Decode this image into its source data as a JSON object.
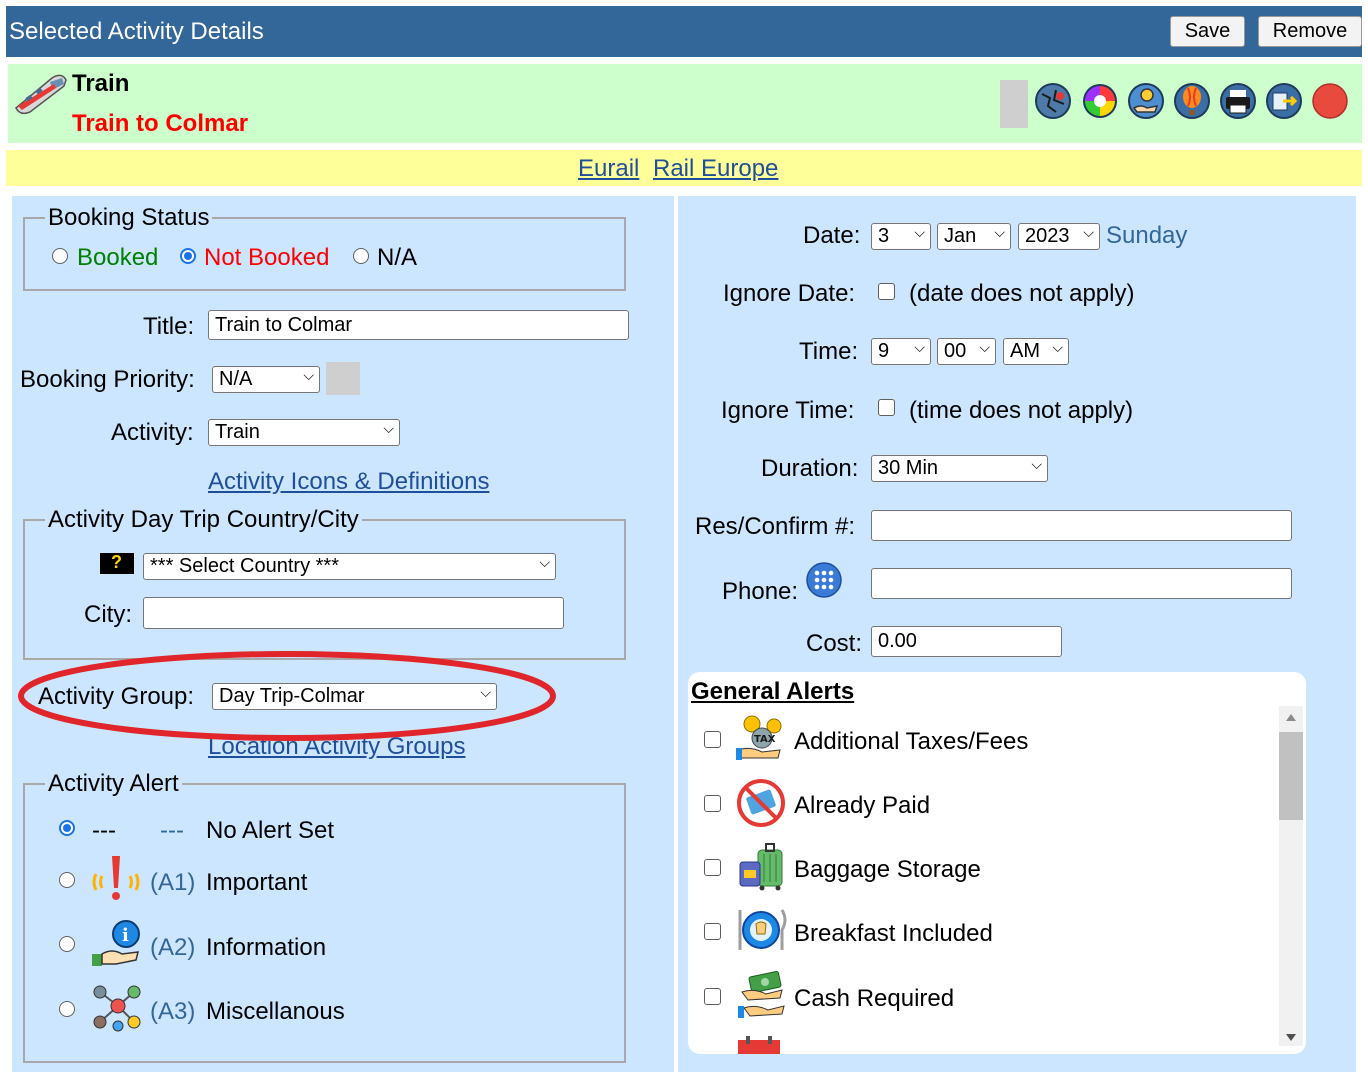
{
  "header": {
    "title": "Selected Activity Details",
    "save_label": "Save",
    "remove_label": "Remove"
  },
  "summary": {
    "type_label": "Train",
    "title": "Train to Colmar"
  },
  "links": {
    "eurail": "Eurail",
    "rail_europe": "Rail Europe"
  },
  "booking_status": {
    "legend": "Booking Status",
    "options": [
      {
        "label": "Booked",
        "color": "#008000",
        "selected": false
      },
      {
        "label": "Not Booked",
        "color": "#ff0000",
        "selected": true
      },
      {
        "label": "N/A",
        "color": "#000000",
        "selected": false
      }
    ]
  },
  "form_left": {
    "title_label": "Title:",
    "title_value": "Train to Colmar",
    "priority_label": "Booking Priority:",
    "priority_value": "N/A",
    "activity_label": "Activity:",
    "activity_value": "Train",
    "activity_icons_link": "Activity Icons & Definitions"
  },
  "day_trip": {
    "legend": "Activity Day Trip Country/City",
    "country_value": "*** Select Country ***",
    "city_label": "City:",
    "city_value": ""
  },
  "activity_group": {
    "label": "Activity Group:",
    "value": "Day Trip-Colmar",
    "link": "Location Activity Groups"
  },
  "activity_alert": {
    "legend": "Activity Alert",
    "options": [
      {
        "code": "---",
        "code2": "---",
        "label": "No Alert Set",
        "selected": true
      },
      {
        "code": "(A1)",
        "label": "Important",
        "icon": "exclamation-alert-icon",
        "selected": false
      },
      {
        "code": "(A2)",
        "label": "Information",
        "icon": "info-hand-icon",
        "selected": false
      },
      {
        "code": "(A3)",
        "label": "Miscellanous",
        "icon": "misc-network-icon",
        "selected": false
      }
    ]
  },
  "form_right": {
    "date_label": "Date:",
    "date_day": "3",
    "date_month": "Jan",
    "date_year": "2023",
    "date_weekday": "Sunday",
    "ignore_date_label": "Ignore Date:",
    "ignore_date_text": "(date does not apply)",
    "time_label": "Time:",
    "time_hour": "9",
    "time_min": "00",
    "time_ampm": "AM",
    "ignore_time_label": "Ignore Time:",
    "ignore_time_text": "(time does not apply)",
    "duration_label": "Duration:",
    "duration_value": "30 Min",
    "res_label": "Res/Confirm #:",
    "res_value": "",
    "phone_label": "Phone:",
    "phone_value": "",
    "cost_label": "Cost:",
    "cost_value": "0.00"
  },
  "general_alerts": {
    "title": "General Alerts",
    "items": [
      {
        "label": "Additional Taxes/Fees",
        "icon": "tax-coins-icon"
      },
      {
        "label": "Already Paid",
        "icon": "no-card-icon"
      },
      {
        "label": "Baggage Storage",
        "icon": "luggage-icon"
      },
      {
        "label": "Breakfast Included",
        "icon": "breakfast-plate-icon"
      },
      {
        "label": "Cash Required",
        "icon": "cash-hand-icon"
      }
    ]
  },
  "colors": {
    "header_bg": "#336699",
    "summary_bg": "#ccffcc",
    "link_bar_bg": "#ffff99",
    "panel_bg": "#cce6ff",
    "weekday": "#336699",
    "alert_code": "#336699",
    "highlight_ellipse": "#e0262b"
  }
}
